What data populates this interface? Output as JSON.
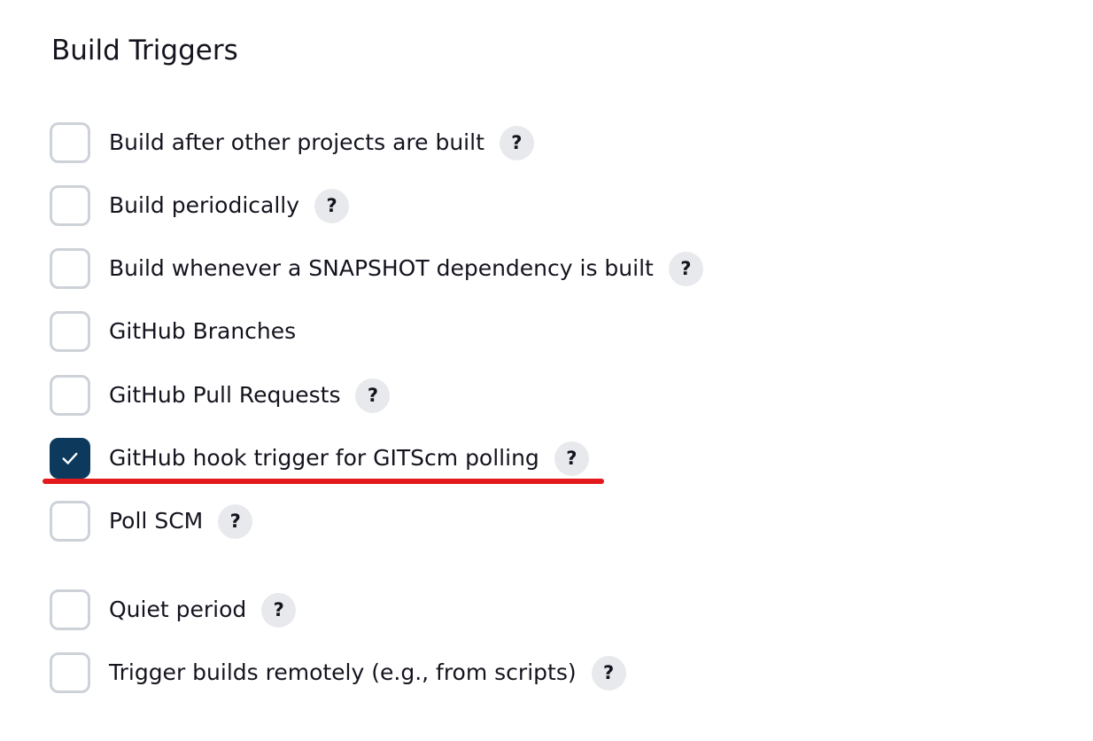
{
  "section": {
    "title": "Build Triggers"
  },
  "options": [
    {
      "label": "Build after other projects are built",
      "checked": false,
      "help": "?"
    },
    {
      "label": "Build periodically",
      "checked": false,
      "help": "?"
    },
    {
      "label": "Build whenever a SNAPSHOT dependency is built",
      "checked": false,
      "help": "?"
    },
    {
      "label": "GitHub Branches",
      "checked": false
    },
    {
      "label": "GitHub Pull Requests",
      "checked": false,
      "help": "?"
    },
    {
      "label": "GitHub hook trigger for GITScm polling",
      "checked": true,
      "help": "?"
    },
    {
      "label": "Poll SCM",
      "checked": false,
      "help": "?"
    },
    {
      "label": "Quiet period",
      "checked": false,
      "help": "?"
    },
    {
      "label": "Trigger builds remotely (e.g., from scripts)",
      "checked": false,
      "help": "?"
    }
  ],
  "colors": {
    "checkbox_checked": "#0d3a5c",
    "checkbox_border": "#cdd2d8",
    "annotation_underline": "#e3191c",
    "help_background": "#e8e9ec"
  },
  "annotation": {
    "type": "underline",
    "target": "GitHub hook trigger for GITScm polling"
  }
}
